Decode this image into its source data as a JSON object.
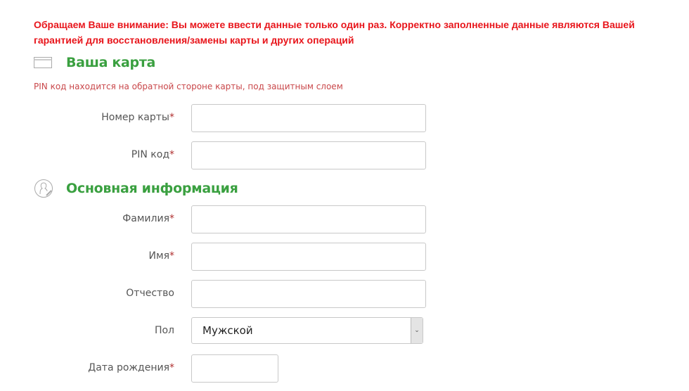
{
  "warning": "Обращаем Ваше внимание: Вы можете ввести данные только один раз. Корректно заполненные данные являются Вашей гарантией для восстановления/замены карты и других операций",
  "card_section": {
    "title": "Ваша карта",
    "icon": "credit-card-icon",
    "note": "PIN код находится на обратной стороне карты, под защитным слоем",
    "fields": [
      {
        "label": "Номер карты",
        "required": "*",
        "value": ""
      },
      {
        "label": "PIN код",
        "required": "*",
        "value": ""
      }
    ]
  },
  "info_section": {
    "title": "Основная информация",
    "icon": "user-edit-icon",
    "fields": [
      {
        "label": "Фамилия",
        "required": "*",
        "value": ""
      },
      {
        "label": "Имя",
        "required": "*",
        "value": ""
      },
      {
        "label": "Отчество",
        "required": "",
        "value": ""
      },
      {
        "label": "Пол",
        "required": "",
        "value": "Мужской"
      },
      {
        "label": "Дата рождения",
        "required": "*",
        "value": ""
      }
    ]
  },
  "colors": {
    "warning": "#e8151b",
    "section_title": "#3aa040",
    "note": "#c9474a"
  }
}
